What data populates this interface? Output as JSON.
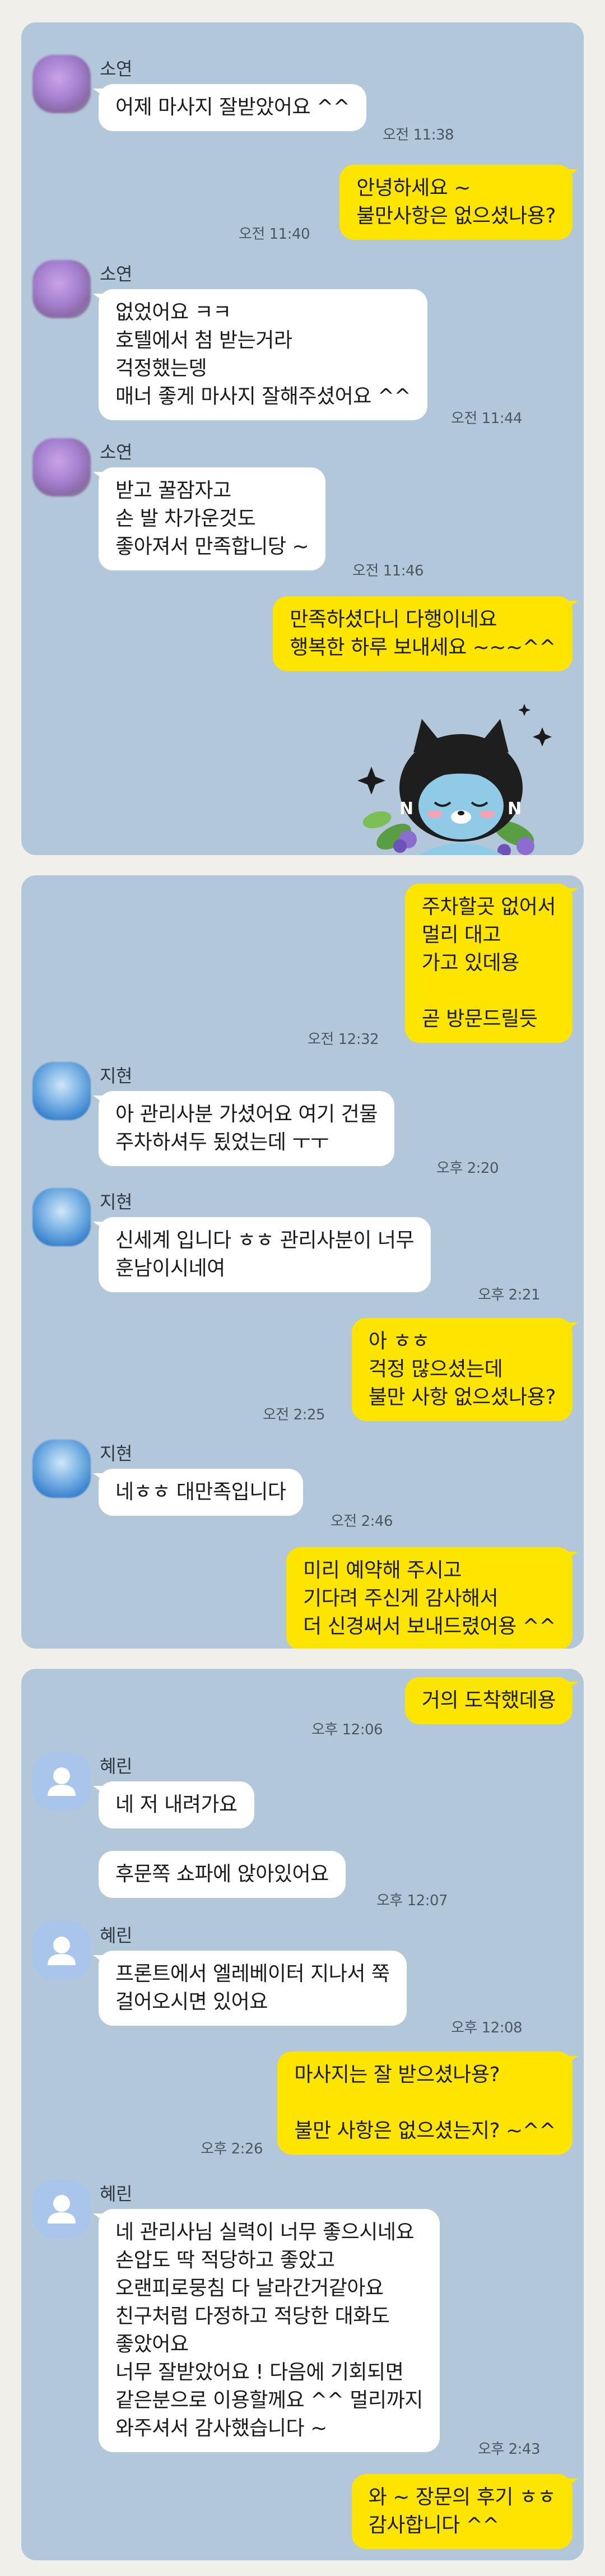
{
  "conversations": [
    {
      "messages": [
        {
          "sender": "소연",
          "text": "어제 마사지 잘받았어요 ^^",
          "time": "오전 11:38"
        },
        {
          "text": "안녕하세요 ~\n불만사항은 없으셨나용?",
          "time": "오전 11:40"
        },
        {
          "sender": "소연",
          "text": "없었어요 ㅋㅋ\n호텔에서 첨 받는거라\n걱정했는뎅\n매너 좋게 마사지 잘해주셨어요 ^^",
          "time": "오전 11:44"
        },
        {
          "sender": "소연",
          "text": "받고 꿀잠자고\n손 발 차가운것도\n좋아져서 만족합니당 ~",
          "time": "오전 11:46"
        },
        {
          "text": "만족하셨다니 다행이네요\n행복한 하루 보내세요 ~~~^^"
        }
      ],
      "emoticon": "kakao-cat-character-emoticon"
    },
    {
      "messages": [
        {
          "text": "주차할곳 없어서\n멀리 대고\n가고 있데용\n\n곧 방문드릴듯",
          "time": "오전 12:32"
        },
        {
          "sender": "지현",
          "text": "아 관리사분 가셨어요 여기 건물\n주차하셔두 됬었는데 ㅜㅜ",
          "time": "오후 2:20"
        },
        {
          "sender": "지현",
          "text": "신세계 입니다 ㅎㅎ 관리사분이 너무\n훈남이시네여",
          "time": "오후 2:21"
        },
        {
          "text": "아 ㅎㅎ\n걱정 많으셨는데\n불만 사항 없으셨나용?",
          "time": "오전 2:25"
        },
        {
          "sender": "지현",
          "text": "네ㅎㅎ 대만족입니다",
          "time": "오전 2:46"
        },
        {
          "text": "미리 예약해 주시고\n기다려 주신게 감사해서\n더 신경써서 보내드렸어용 ^^"
        }
      ]
    },
    {
      "messages": [
        {
          "text": "거의 도착했데용",
          "time": "오후 12:06"
        },
        {
          "sender": "혜린",
          "text": "네 저 내려가요"
        },
        {
          "text": "후문쪽 쇼파에 앉아있어요",
          "time": "오후 12:07"
        },
        {
          "sender": "혜린",
          "text": "프론트에서 엘레베이터 지나서 쭉\n걸어오시면 있어요",
          "time": "오후 12:08"
        },
        {
          "text": "마사지는 잘 받으셨나용?\n\n불만 사항은 없으셨는지? ~^^",
          "time": "오후 2:26"
        },
        {
          "sender": "혜린",
          "text": "네 관리사님 실력이 너무 좋으시네요\n손압도 딱 적당하고 좋았고\n오랜피로뭉침 다 날라간거같아요\n친구처럼 다정하고 적당한 대화도\n좋았어요\n너무 잘받았어요 ! 다음에 기회되면\n같은분으로 이용할께요 ^^ 멀리까지\n와주셔서 감사했습니다 ~",
          "time": "오후 2:43"
        },
        {
          "text": "와 ~ 장문의 후기 ㅎㅎ\n감사합니다 ^^"
        }
      ]
    }
  ],
  "colors": {
    "chat_background": "#b2c7da",
    "outgoing_bubble": "#fee500",
    "incoming_bubble": "#ffffff",
    "page_background": "#f1efea"
  }
}
